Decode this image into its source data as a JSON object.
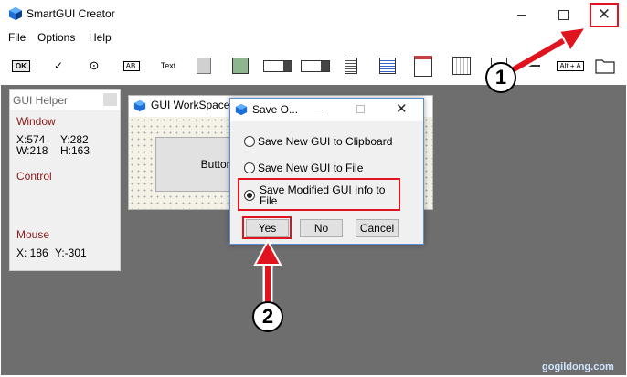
{
  "app": {
    "title": "SmartGUI Creator"
  },
  "menu": [
    "File",
    "Options",
    "Help"
  ],
  "toolbar": {
    "ok_label": "OK",
    "checkbox_glyph": "✓",
    "radio_glyph": "⊙",
    "edit_label": "AB",
    "text_label": "Text",
    "hotkey_label": "Alt + A"
  },
  "gui_helper": {
    "title": "GUI Helper",
    "window_heading": "Window",
    "x": "X:574",
    "y": "Y:282",
    "w": "W:218",
    "h": "H:163",
    "control_heading": "Control",
    "mouse_heading": "Mouse",
    "mouse_x": "X: 186",
    "mouse_y": "Y:-301"
  },
  "workspace": {
    "title": "GUI WorkSpace",
    "button_label": "Button"
  },
  "dialog": {
    "title": "Save O...",
    "options": [
      "Save New GUI to Clipboard",
      "Save New GUI to File",
      "Save Modified GUI Info to File"
    ],
    "selected_index": 2,
    "yes_label": "Yes",
    "no_label": "No",
    "cancel_label": "Cancel"
  },
  "annotations": {
    "step1": "1",
    "step2": "2",
    "highlight_color": "#e0141e"
  },
  "watermark": "gogildong.com"
}
